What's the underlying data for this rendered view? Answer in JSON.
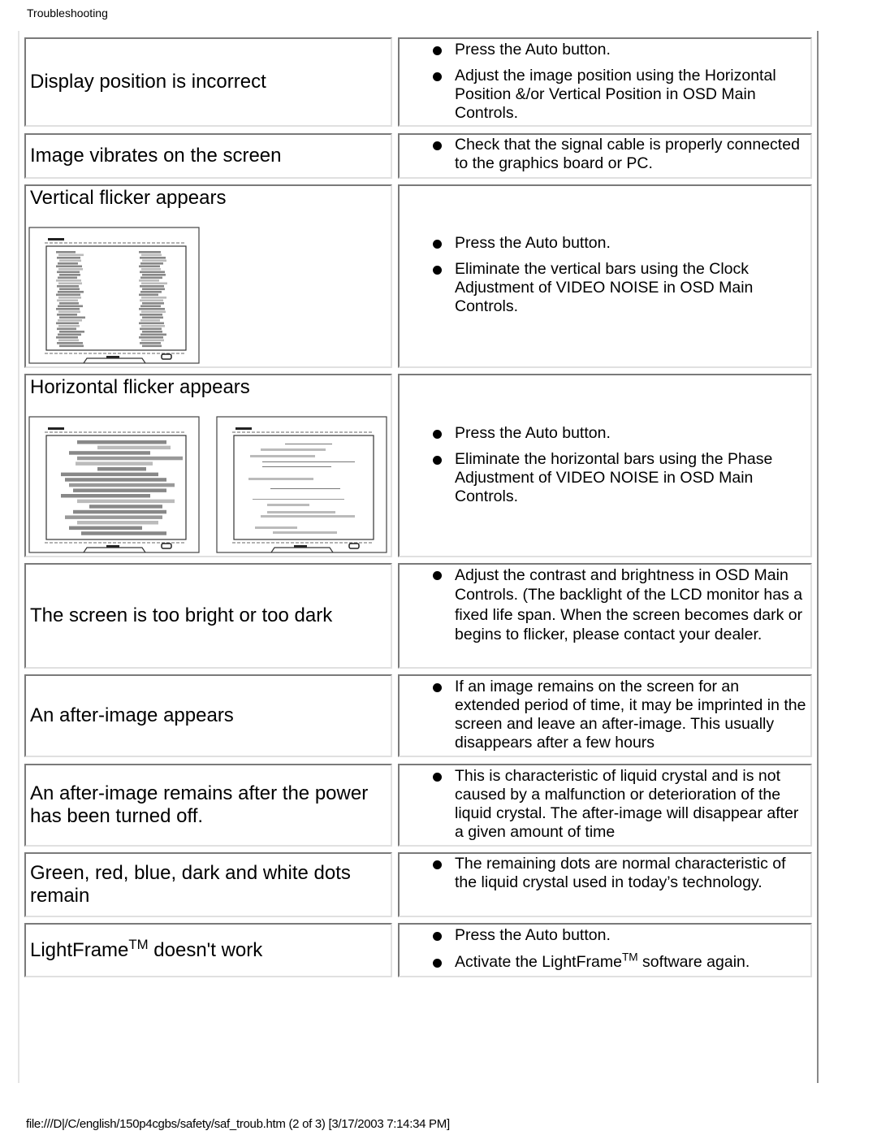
{
  "page": {
    "header": "Troubleshooting",
    "footer": "file:///D|/C/english/150p4cgbs/safety/saf_troub.htm (2 of 3) [3/17/2003 7:14:34 PM]"
  },
  "rows": [
    {
      "problem": "Display position is incorrect",
      "solutions": [
        "Press the Auto button.",
        "Adjust the image position using the Horizontal Position &/or Vertical Position in OSD Main Controls."
      ]
    },
    {
      "problem": "Image vibrates on the screen",
      "solutions": [
        "Check that the signal cable is properly connected to the graphics board or PC."
      ]
    },
    {
      "problem": "Vertical flicker appears",
      "image": "monitor-vertical-flicker-illustration",
      "solutions": [
        "Press the Auto button.",
        "Eliminate the vertical bars using the Clock Adjustment of VIDEO NOISE in OSD Main Controls."
      ]
    },
    {
      "problem": "Horizontal flicker appears",
      "images": [
        "monitor-horizontal-flicker-heavy-illustration",
        "monitor-horizontal-flicker-light-illustration"
      ],
      "solutions": [
        "Press the Auto button.",
        "Eliminate the horizontal bars using the Phase Adjustment of VIDEO NOISE in OSD Main Controls."
      ]
    },
    {
      "problem": "The screen is too bright or too dark",
      "solutions": [
        "Adjust the contrast and brightness in OSD Main Controls. (The backlight of the LCD monitor has a fixed life span. When the screen becomes dark or begins to flicker, please contact your dealer."
      ]
    },
    {
      "problem": "An after-image appears",
      "solutions": [
        "If an image remains on the screen for an extended period of time, it may be imprinted in the screen and leave an after-image. This usually disappears after a few hours"
      ]
    },
    {
      "problem": "An after-image remains after the power has been turned off.",
      "solutions": [
        "This is characteristic of liquid crystal and is not caused by a malfunction or deterioration of the liquid crystal. The after-image will disappear after a given amount of time"
      ]
    },
    {
      "problem": "Green, red, blue, dark and white dots remain",
      "solutions": [
        "The remaining dots are normal characteristic of the liquid crystal used in today’s technology."
      ]
    },
    {
      "problem_prefix": "LightFrame",
      "problem_sup": "TM",
      "problem_suffix": " doesn't work",
      "solutions": [
        "Press the Auto button."
      ],
      "solution_rich": {
        "prefix": "Activate the LightFrame",
        "sup": "TM",
        "suffix": " software again."
      }
    }
  ]
}
